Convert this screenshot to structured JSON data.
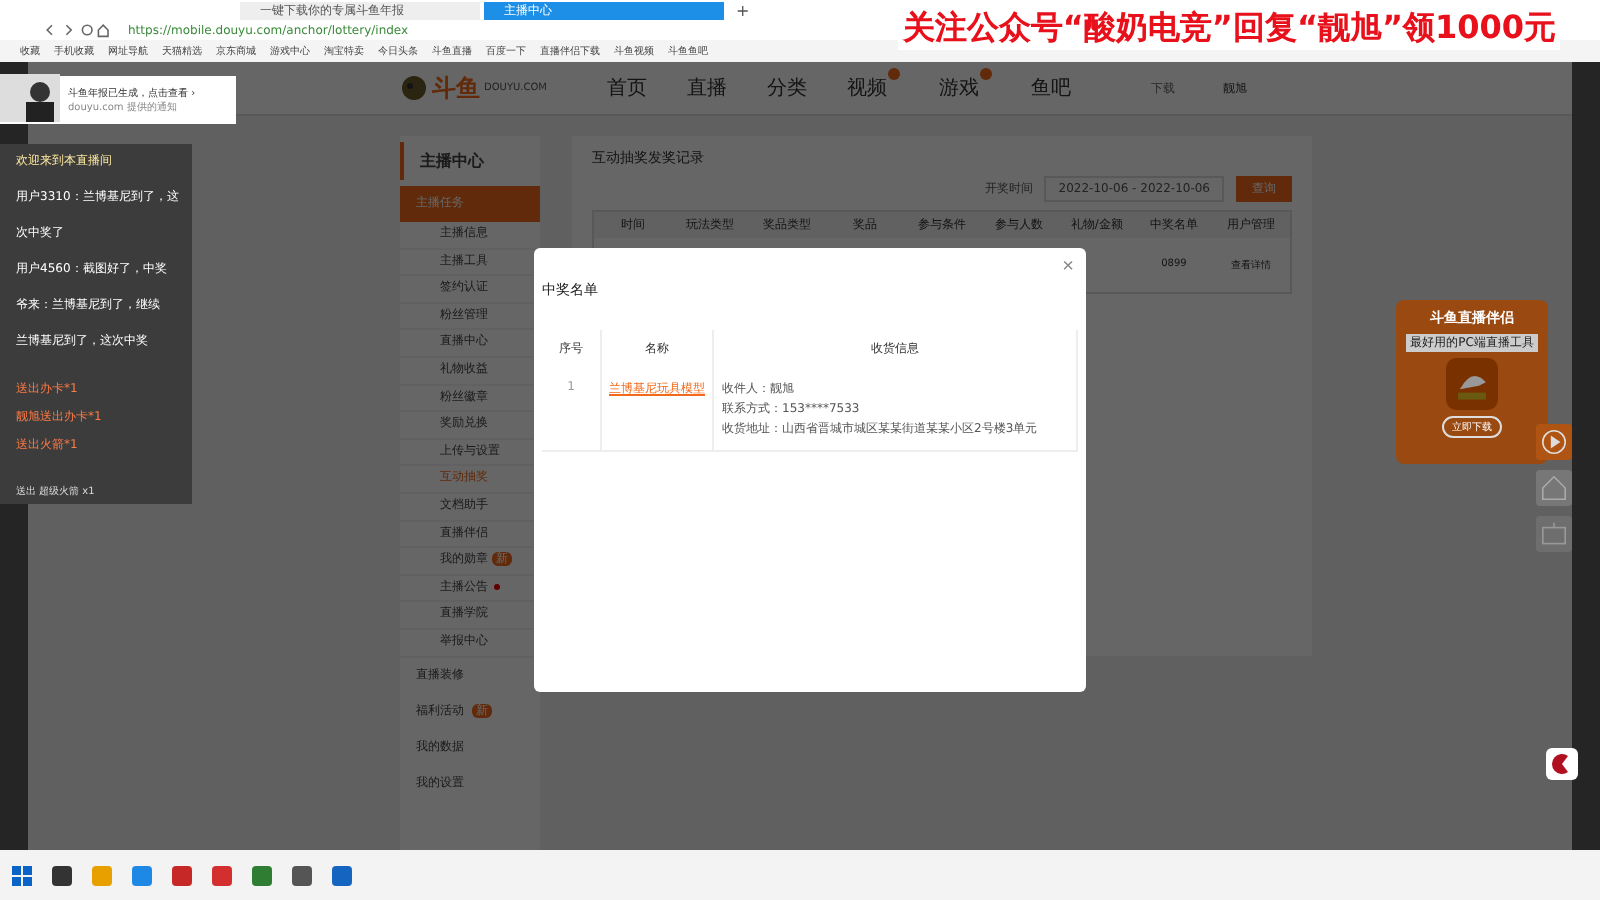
{
  "browser": {
    "tabs": [
      {
        "label": "一键下载你的专属斗鱼年报",
        "selected": false
      },
      {
        "label": "主播中心",
        "selected": true
      }
    ],
    "new_tab": "+",
    "address": "https://mobile.douyu.com/anchor/lottery/index",
    "bookmarks": [
      "收藏",
      "手机收藏",
      "网址导航",
      "天猫精选",
      "京东商城",
      "游戏中心",
      "淘宝特卖",
      "今日头条",
      "斗鱼直播",
      "百度一下",
      "直播伴侣下载",
      "斗鱼视频",
      "斗鱼鱼吧"
    ]
  },
  "banner": "关注公众号“酸奶电竞”回复“靓旭”领1000元",
  "notification": {
    "title": "斗鱼年报已生成，点击查看 ›",
    "subtitle": "douyu.com 提供的通知"
  },
  "header": {
    "logo": "斗鱼",
    "logo_sub": "DOUYU.COM",
    "nav": [
      {
        "label": "首页",
        "badge": false
      },
      {
        "label": "直播",
        "badge": false
      },
      {
        "label": "分类",
        "badge": false
      },
      {
        "label": "视频",
        "badge": true
      },
      {
        "label": "游戏",
        "badge": true
      },
      {
        "label": "鱼吧",
        "badge": false
      }
    ],
    "client": "下载",
    "user": "靓旭"
  },
  "chat": {
    "messages": [
      {
        "text": "欢迎来到本直播间",
        "kind": "system"
      },
      {
        "name": "用户3310：",
        "text": "兰博基尼到了，这",
        "kind": "user"
      },
      {
        "text": "次中奖了",
        "kind": "user"
      },
      {
        "name": "用户4560：",
        "text": "截图好了，中奖",
        "kind": "user"
      },
      {
        "name": "爷来：",
        "text": "兰博基尼到了，继续",
        "kind": "user"
      },
      {
        "text": "兰博基尼到了，这次中奖",
        "kind": "user"
      }
    ],
    "gifts": [
      "送出办卡*1",
      "靓旭送出办卡*1",
      "送出火箭*1"
    ],
    "footer": "送出 超级火箭 x1"
  },
  "sidebar": {
    "title": "主播中心",
    "groups": [
      {
        "label": "主播任务",
        "expanded": true,
        "children": [
          {
            "label": "主播信息",
            "selected": false
          },
          {
            "label": "主播工具",
            "selected": false
          },
          {
            "label": "签约认证",
            "selected": false
          },
          {
            "label": "粉丝管理",
            "selected": false
          },
          {
            "label": "直播中心",
            "selected": false
          },
          {
            "label": "礼物收益",
            "selected": false
          },
          {
            "label": "粉丝徽章",
            "selected": false
          },
          {
            "label": "奖励兑换",
            "selected": false
          },
          {
            "label": "上传与设置",
            "selected": false
          },
          {
            "label": "互动抽奖",
            "selected": true
          },
          {
            "label": "文档助手",
            "selected": false
          },
          {
            "label": "直播伴侣",
            "selected": false
          },
          {
            "label": "我的勋章",
            "selected": false,
            "tag": "新"
          },
          {
            "label": "主播公告",
            "selected": false,
            "dot": true
          },
          {
            "label": "直播学院",
            "selected": false
          },
          {
            "label": "举报中心",
            "selected": false
          }
        ]
      },
      {
        "label": "直播装修",
        "expanded": false
      },
      {
        "label": "福利活动",
        "expanded": false,
        "tag": "新"
      },
      {
        "label": "我的数据",
        "expanded": false
      },
      {
        "label": "我的设置",
        "expanded": false
      }
    ]
  },
  "content": {
    "title": "互动抽奖发奖记录",
    "date_label": "开奖时间",
    "date_range": "2022-10-06 - 2022-10-06",
    "search_button": "查询",
    "columns": [
      "时间",
      "玩法类型",
      "奖品类型",
      "奖品",
      "参与条件",
      "参与人数",
      "礼物/金额",
      "中奖名单",
      "用户管理"
    ],
    "row_visible": [
      "0899",
      "查看详情"
    ]
  },
  "modal": {
    "title": "中奖名单",
    "close": "×",
    "columns": [
      "序号",
      "名称",
      "收货信息"
    ],
    "rows": [
      {
        "index": "1",
        "prize": "兰博基尼玩具模型",
        "info": [
          "收件人：靓旭",
          "联系方式：153****7533",
          "收货地址：山西省晋城市城区某某街道某某小区2号楼3单元"
        ]
      }
    ]
  },
  "ad": {
    "title": "斗鱼直播伴侣",
    "subtitle": "最好用的PC端直播工具",
    "button": "立即下载"
  }
}
